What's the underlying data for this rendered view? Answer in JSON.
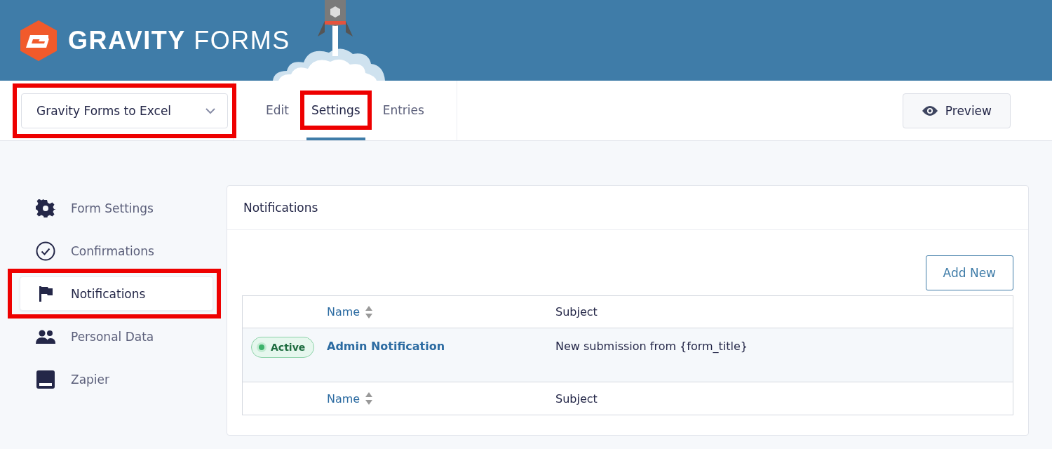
{
  "header": {
    "logo_text": "**GRAVITY** FORMS"
  },
  "toolbar": {
    "form_selector": {
      "value": "Gravity Forms to Excel",
      "highlighted": true
    },
    "tabs": [
      {
        "label": "Edit",
        "selected": false,
        "highlighted": false
      },
      {
        "label": "Settings",
        "selected": true,
        "highlighted": true
      },
      {
        "label": "Entries",
        "selected": false,
        "highlighted": false
      }
    ],
    "preview_button": "Preview"
  },
  "sidebar": {
    "items": [
      {
        "kind": "gear",
        "label": "Form Settings",
        "selected": false,
        "highlighted": false
      },
      {
        "kind": "check",
        "label": "Confirmations",
        "selected": false,
        "highlighted": false
      },
      {
        "kind": "flag",
        "label": "Notifications",
        "selected": true,
        "highlighted": true
      },
      {
        "kind": "people",
        "label": "Personal Data",
        "selected": false,
        "highlighted": false
      },
      {
        "kind": "panel",
        "label": "Zapier",
        "selected": false,
        "highlighted": false
      }
    ]
  },
  "panel": {
    "title": "Notifications",
    "add_button": "Add New",
    "table": {
      "columns": [
        "Name",
        "Subject"
      ],
      "rows": [
        {
          "status": "Active",
          "active": true,
          "name": "Admin Notification",
          "subject": "New submission from {form_title}"
        }
      ],
      "footer_columns": [
        "Name",
        "Subject"
      ]
    }
  }
}
